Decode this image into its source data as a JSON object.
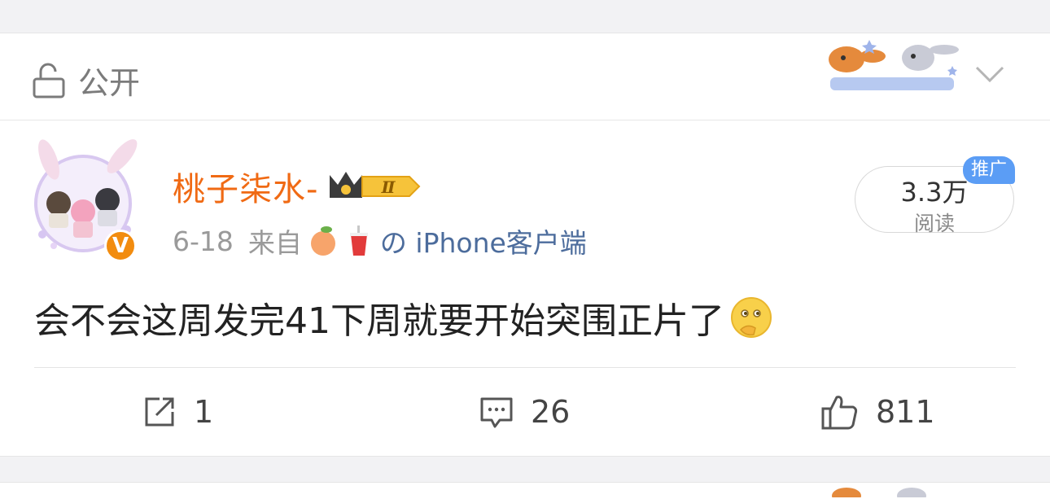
{
  "visibility": {
    "label": "公开",
    "icon": "unlock-icon"
  },
  "post": {
    "author": "桃子柒水-",
    "member_badge": "Ⅱ",
    "verified_badge": "V",
    "date": "6-18",
    "from_label": "来自",
    "source": "の iPhone客户端",
    "reads": {
      "count": "3.3万",
      "label": "阅读",
      "tag": "推广"
    },
    "text": "会不会这周发完41下周就要开始突围正片了",
    "actions": {
      "repost": "1",
      "comment": "26",
      "like": "811"
    }
  },
  "colors": {
    "author": "#f06a14",
    "source": "#4c6c9c",
    "tag": "#5b9df5",
    "verified": "#f28c0f"
  }
}
